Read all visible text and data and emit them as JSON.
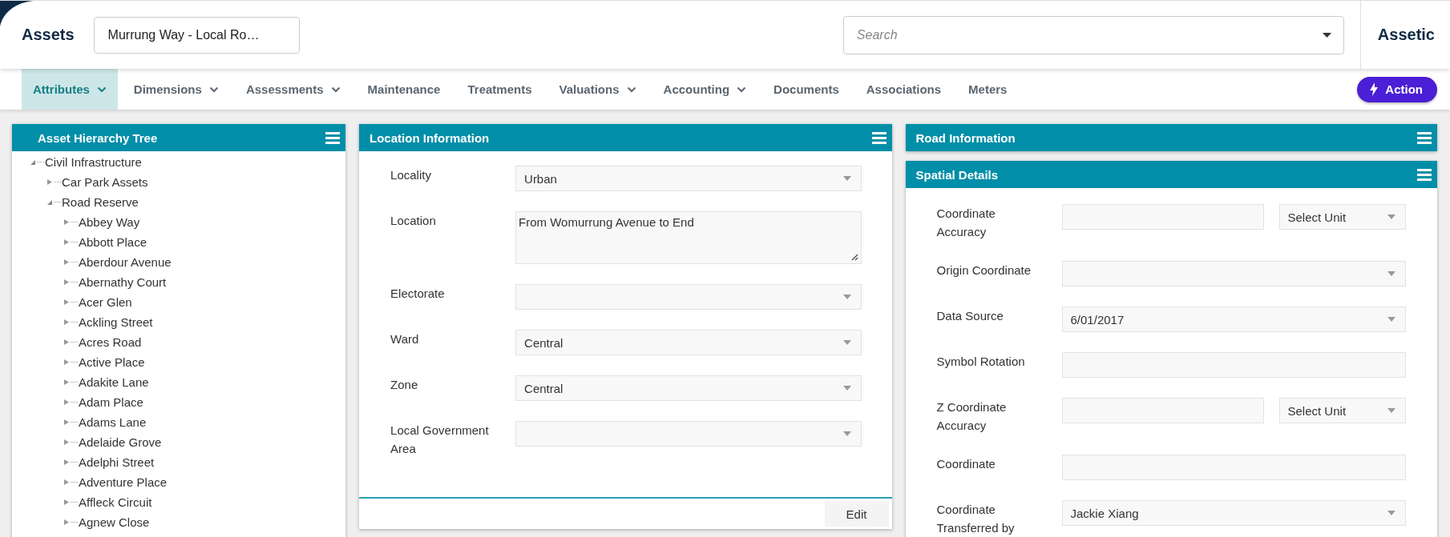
{
  "header": {
    "title": "Assets",
    "record": "Murrung Way - Local Ro…",
    "search": {
      "placeholder": "Search"
    },
    "brand": "Assetic"
  },
  "nav": [
    {
      "label": "Attributes",
      "has_menu": true,
      "selected": true
    },
    {
      "label": "Dimensions",
      "has_menu": true,
      "selected": false
    },
    {
      "label": "Assessments",
      "has_menu": true,
      "selected": false
    },
    {
      "label": "Maintenance",
      "has_menu": false,
      "selected": false
    },
    {
      "label": "Treatments",
      "has_menu": false,
      "selected": false
    },
    {
      "label": "Valuations",
      "has_menu": true,
      "selected": false
    },
    {
      "label": "Accounting",
      "has_menu": true,
      "selected": false
    },
    {
      "label": "Documents",
      "has_menu": false,
      "selected": false
    },
    {
      "label": "Associations",
      "has_menu": false,
      "selected": false
    },
    {
      "label": "Meters",
      "has_menu": false,
      "selected": false
    }
  ],
  "action_button": "Action",
  "tree": {
    "title": "Asset Hierarchy Tree",
    "items": [
      {
        "label": "Civil Infrastructure",
        "expanded": true,
        "children": [
          {
            "label": "Car Park Assets",
            "expanded": false
          },
          {
            "label": "Road Reserve",
            "expanded": true,
            "children": [
              {
                "label": "Abbey Way",
                "expanded": false
              },
              {
                "label": "Abbott Place",
                "expanded": false
              },
              {
                "label": "Aberdour Avenue",
                "expanded": false
              },
              {
                "label": "Abernathy Court",
                "expanded": false
              },
              {
                "label": "Acer Glen",
                "expanded": false
              },
              {
                "label": "Ackling Street",
                "expanded": false
              },
              {
                "label": "Acres Road",
                "expanded": false
              },
              {
                "label": "Active Place",
                "expanded": false
              },
              {
                "label": "Adakite Lane",
                "expanded": false
              },
              {
                "label": "Adam Place",
                "expanded": false
              },
              {
                "label": "Adams Lane",
                "expanded": false
              },
              {
                "label": "Adelaide Grove",
                "expanded": false
              },
              {
                "label": "Adelphi Street",
                "expanded": false
              },
              {
                "label": "Adventure Place",
                "expanded": false
              },
              {
                "label": "Affleck Circuit",
                "expanded": false
              },
              {
                "label": "Agnew Close",
                "expanded": false
              }
            ]
          }
        ]
      }
    ]
  },
  "location_panel": {
    "title": "Location Information",
    "fields": [
      {
        "label": "Locality",
        "kind": "select",
        "value": "Urban"
      },
      {
        "label": "Location",
        "kind": "textarea",
        "value": "From Womurrung Avenue to End"
      },
      {
        "label": "Electorate",
        "kind": "select"
      },
      {
        "label": "Ward",
        "kind": "select",
        "value": "Central"
      },
      {
        "label": "Zone",
        "kind": "select",
        "value": "Central"
      },
      {
        "label": "Local Government Area",
        "kind": "select"
      }
    ],
    "edit_button": "Edit"
  },
  "road_panel": {
    "title": "Road Information"
  },
  "spatial_panel": {
    "title": "Spatial Details",
    "fields": [
      {
        "label": "Coordinate Accuracy",
        "kind": "measure",
        "unit": "Select Unit"
      },
      {
        "label": "Origin Coordinate",
        "kind": "select"
      },
      {
        "label": "Data Source",
        "kind": "select",
        "value": "6/01/2017"
      },
      {
        "label": "Symbol Rotation",
        "kind": "text"
      },
      {
        "label": "Z Coordinate Accuracy",
        "kind": "measure",
        "unit": "Select Unit"
      },
      {
        "label": "Coordinate",
        "kind": "text"
      },
      {
        "label": "Coordinate Transferred by",
        "kind": "select",
        "value": "Jackie Xiang"
      }
    ]
  }
}
